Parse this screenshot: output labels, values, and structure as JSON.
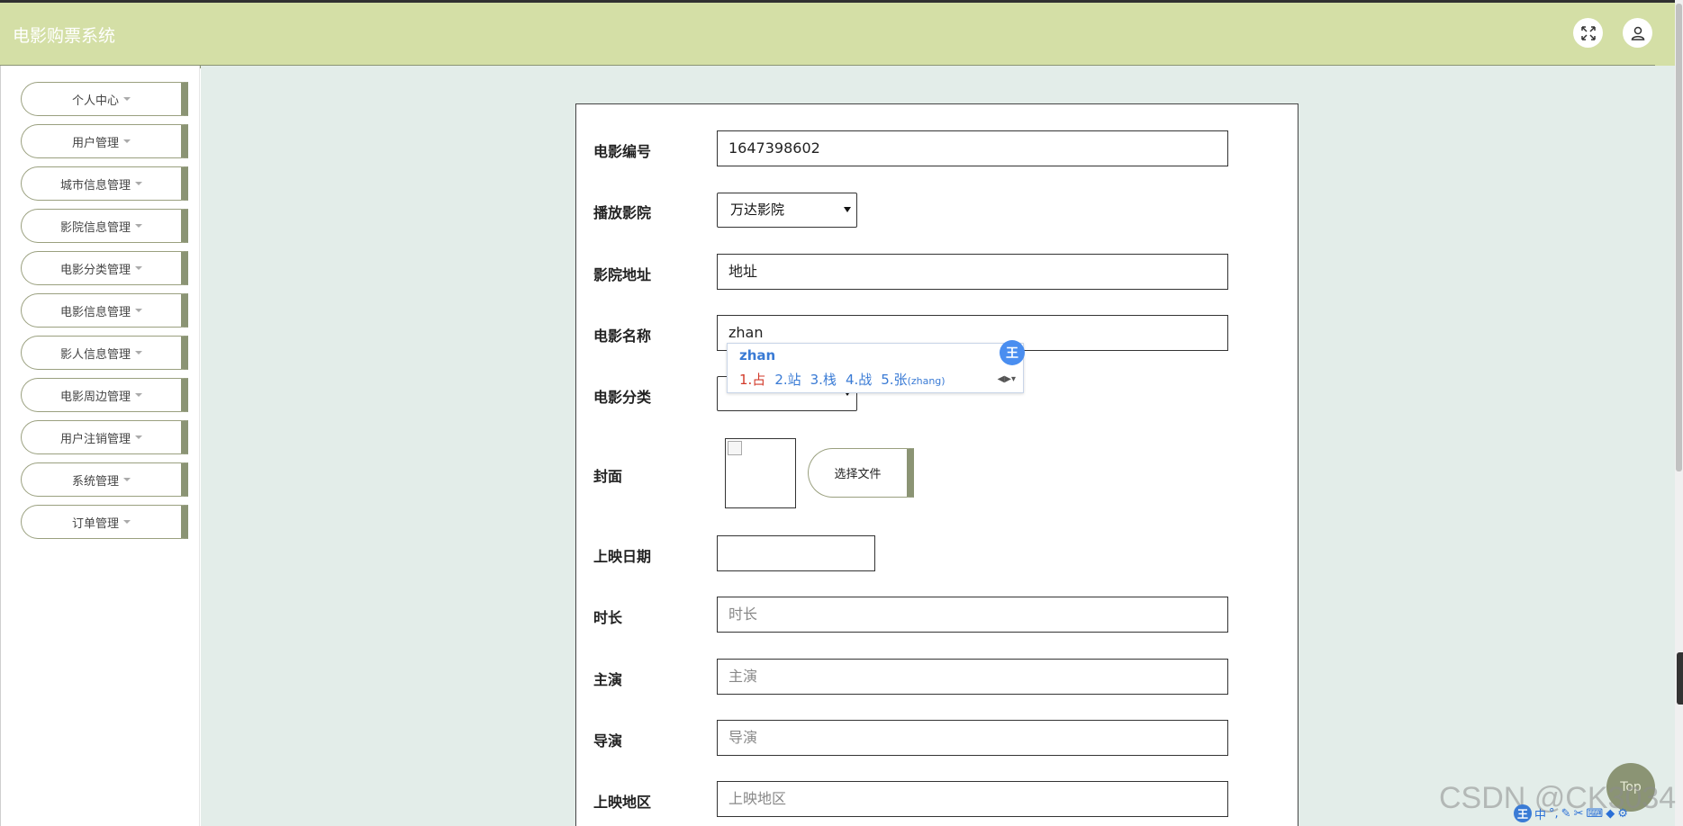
{
  "header": {
    "title": "电影购票系统",
    "fullscreen_icon": "expand-icon",
    "user_icon": "user-icon"
  },
  "sidebar": {
    "items": [
      {
        "label": "个人中心"
      },
      {
        "label": "用户管理"
      },
      {
        "label": "城市信息管理"
      },
      {
        "label": "影院信息管理"
      },
      {
        "label": "电影分类管理"
      },
      {
        "label": "电影信息管理"
      },
      {
        "label": "影人信息管理"
      },
      {
        "label": "电影周边管理"
      },
      {
        "label": "用户注销管理"
      },
      {
        "label": "系统管理"
      },
      {
        "label": "订单管理"
      }
    ]
  },
  "form": {
    "movie_no": {
      "label": "电影编号",
      "value": "1647398602"
    },
    "cinema": {
      "label": "播放影院",
      "value": "万达影院"
    },
    "address": {
      "label": "影院地址",
      "value": "地址"
    },
    "movie_name": {
      "label": "电影名称",
      "value": "zhan"
    },
    "category": {
      "label": "电影分类",
      "value": ""
    },
    "cover": {
      "label": "封面",
      "button": "选择文件"
    },
    "release_date": {
      "label": "上映日期",
      "value": ""
    },
    "duration": {
      "label": "时长",
      "placeholder": "时长"
    },
    "starring": {
      "label": "主演",
      "placeholder": "主演"
    },
    "director": {
      "label": "导演",
      "placeholder": "导演"
    },
    "region": {
      "label": "上映地区",
      "placeholder": "上映地区"
    }
  },
  "ime": {
    "composition": "zhan",
    "candidates": [
      "1.占",
      "2.站",
      "3.栈",
      "4.战",
      "5.张"
    ],
    "pinyin_hint": "(zhang)",
    "badge": "王"
  },
  "overlay": {
    "top_button": "Top",
    "watermark": "CSDN @CK3034",
    "tray_logo": "王",
    "tray_lang": "中"
  },
  "colors": {
    "header_bg": "#d4dfa6",
    "accent": "#8b9474",
    "main_bg": "#e3ede9"
  }
}
